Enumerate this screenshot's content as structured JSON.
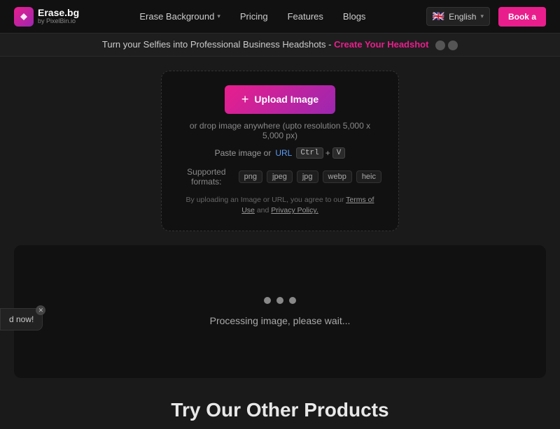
{
  "navbar": {
    "logo_text": "Erase.bg",
    "logo_sub": "by PixelBin.io",
    "logo_icon": "E",
    "links": [
      {
        "label": "Erase Background",
        "has_chevron": true
      },
      {
        "label": "Pricing",
        "has_chevron": false
      },
      {
        "label": "Features",
        "has_chevron": false
      },
      {
        "label": "Blogs",
        "has_chevron": false
      }
    ],
    "lang_flag": "🇬🇧",
    "lang_label": "English",
    "book_label": "Book a"
  },
  "announcement": {
    "text": "Turn your Selfies into Professional Business Headshots -",
    "link_text": "Create Your Headshot"
  },
  "upload": {
    "button_label": "Upload Image",
    "drop_text": "or drop image anywhere (upto resolution 5,000 x 5,000 px)",
    "paste_label": "Paste image or",
    "url_label": "URL",
    "ctrl_label": "Ctrl",
    "plus_label": "+",
    "v_label": "V",
    "formats_label": "Supported formats:",
    "formats": [
      "png",
      "jpeg",
      "jpg",
      "webp",
      "heic"
    ],
    "terms_text": "By uploading an Image or URL, you agree to our",
    "terms_link": "Terms of Use",
    "and_text": "and",
    "privacy_link": "Privacy Policy."
  },
  "processing": {
    "text": "Processing image, please wait..."
  },
  "bottom": {
    "title": "Try Our Other Products"
  },
  "chat": {
    "label": "d now!"
  }
}
